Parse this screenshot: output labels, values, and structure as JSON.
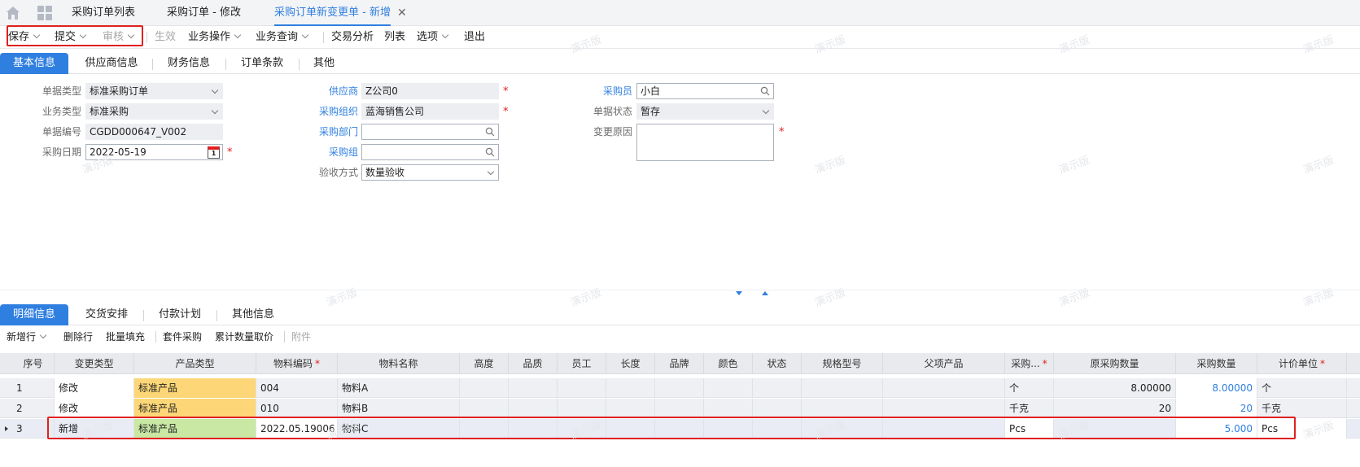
{
  "top_tabs": [
    {
      "label": "采购订单列表"
    },
    {
      "label": "采购订单 - 修改"
    },
    {
      "label": "采购订单新变更单 - 新增"
    }
  ],
  "toolbar": {
    "save": "保存",
    "submit": "提交",
    "audit": "审核",
    "effect": "生效",
    "biz_ops": "业务操作",
    "biz_query": "业务查询",
    "trade_analysis": "交易分析",
    "list": "列表",
    "options": "选项",
    "exit": "退出"
  },
  "section_tabs": [
    "基本信息",
    "供应商信息",
    "财务信息",
    "订单条款",
    "其他"
  ],
  "form": {
    "doc_type": {
      "label": "单据类型",
      "value": "标准采购订单"
    },
    "biz_type": {
      "label": "业务类型",
      "value": "标准采购"
    },
    "doc_no": {
      "label": "单据编号",
      "value": "CGDD000647_V002"
    },
    "purchase_date": {
      "label": "采购日期",
      "value": "2022-05-19",
      "cal_day": "1"
    },
    "supplier": {
      "label": "供应商",
      "value": "Z公司0"
    },
    "purchase_org": {
      "label": "采购组织",
      "value": "蓝海销售公司"
    },
    "purchase_dept": {
      "label": "采购部门",
      "value": ""
    },
    "purchase_group": {
      "label": "采购组",
      "value": ""
    },
    "acceptance": {
      "label": "验收方式",
      "value": "数量验收"
    },
    "buyer": {
      "label": "采购员",
      "value": "小白"
    },
    "doc_status": {
      "label": "单据状态",
      "value": "暂存"
    },
    "change_reason": {
      "label": "变更原因",
      "value": ""
    },
    "required_mark": "*"
  },
  "detail_tabs": [
    "明细信息",
    "交货安排",
    "付款计划",
    "其他信息"
  ],
  "grid_toolbar": {
    "add_row": "新增行",
    "delete_row": "删除行",
    "batch_fill": "批量填充",
    "kit_purchase": "套件采购",
    "cumulative_qty": "累计数量取价",
    "attachment": "附件"
  },
  "table": {
    "columns": [
      "序号",
      "变更类型",
      "产品类型",
      "物料编码",
      "物料名称",
      "高度",
      "品质",
      "员工",
      "长度",
      "品牌",
      "颜色",
      "状态",
      "规格型号",
      "父项产品",
      "采购...",
      "原采购数量",
      "采购数量",
      "计价单位"
    ],
    "required_mark": "*",
    "rows": [
      {
        "seq": "1",
        "change_type": "修改",
        "product_type": "标准产品",
        "material_code": "004",
        "material_name": "物料A",
        "purchase_unit": "个",
        "orig_qty": "8.00000",
        "qty": "8.00000",
        "price_unit": "个"
      },
      {
        "seq": "2",
        "change_type": "修改",
        "product_type": "标准产品",
        "material_code": "010",
        "material_name": "物料B",
        "purchase_unit": "千克",
        "orig_qty": "20",
        "qty": "20",
        "price_unit": "千克"
      },
      {
        "seq": "3",
        "change_type": "新增",
        "product_type": "标准产品",
        "material_code": "2022.05.19006",
        "material_name": "物料C",
        "purchase_unit": "Pcs",
        "orig_qty": "",
        "qty": "5.000",
        "price_unit": "Pcs"
      }
    ]
  },
  "watermark": "演示版",
  "colors": {
    "accent": "#2f7fe0",
    "highlight_box": "#e02020",
    "product_modified": "#fdd777",
    "product_new": "#c9e8a4"
  }
}
